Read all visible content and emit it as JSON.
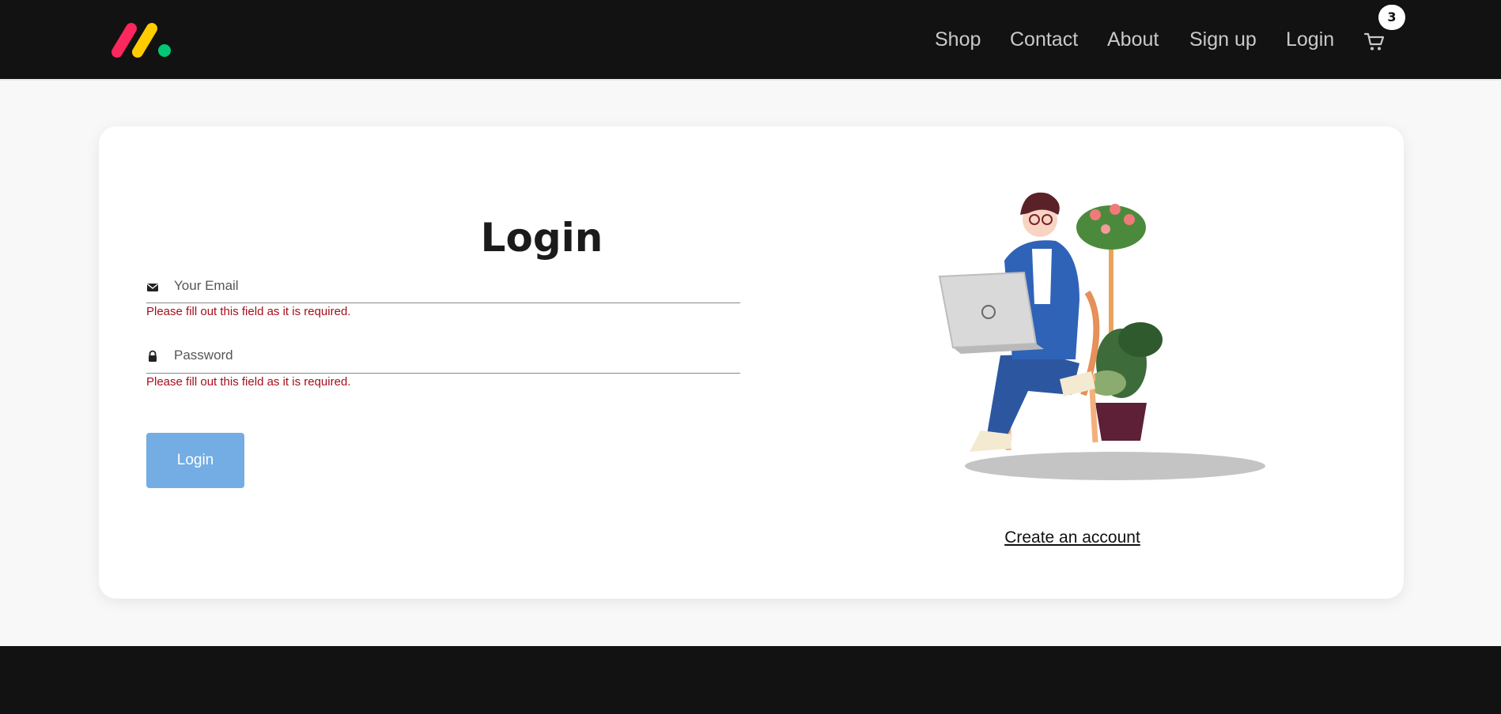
{
  "header": {
    "nav": [
      {
        "id": "shop",
        "label": "Shop"
      },
      {
        "id": "contact",
        "label": "Contact"
      },
      {
        "id": "about",
        "label": "About"
      },
      {
        "id": "signup",
        "label": "Sign up"
      },
      {
        "id": "login",
        "label": "Login"
      }
    ],
    "cart": {
      "count": "3",
      "icon": "cart-icon"
    },
    "logo_colors": [
      "#fb275d",
      "#ffcc00",
      "#00c875"
    ]
  },
  "login_form": {
    "title": "Login",
    "email": {
      "placeholder": "Your Email",
      "value": "",
      "icon": "envelope-icon",
      "error": "Please fill out this field as it is required."
    },
    "password": {
      "placeholder": "Password",
      "value": "",
      "icon": "lock-icon",
      "error": "Please fill out this field as it is required."
    },
    "submit_label": "Login"
  },
  "side": {
    "create_account_label": "Create an account"
  },
  "colors": {
    "header_bg": "#121212",
    "button_bg": "#73ade3",
    "error": "#a50f1a"
  }
}
